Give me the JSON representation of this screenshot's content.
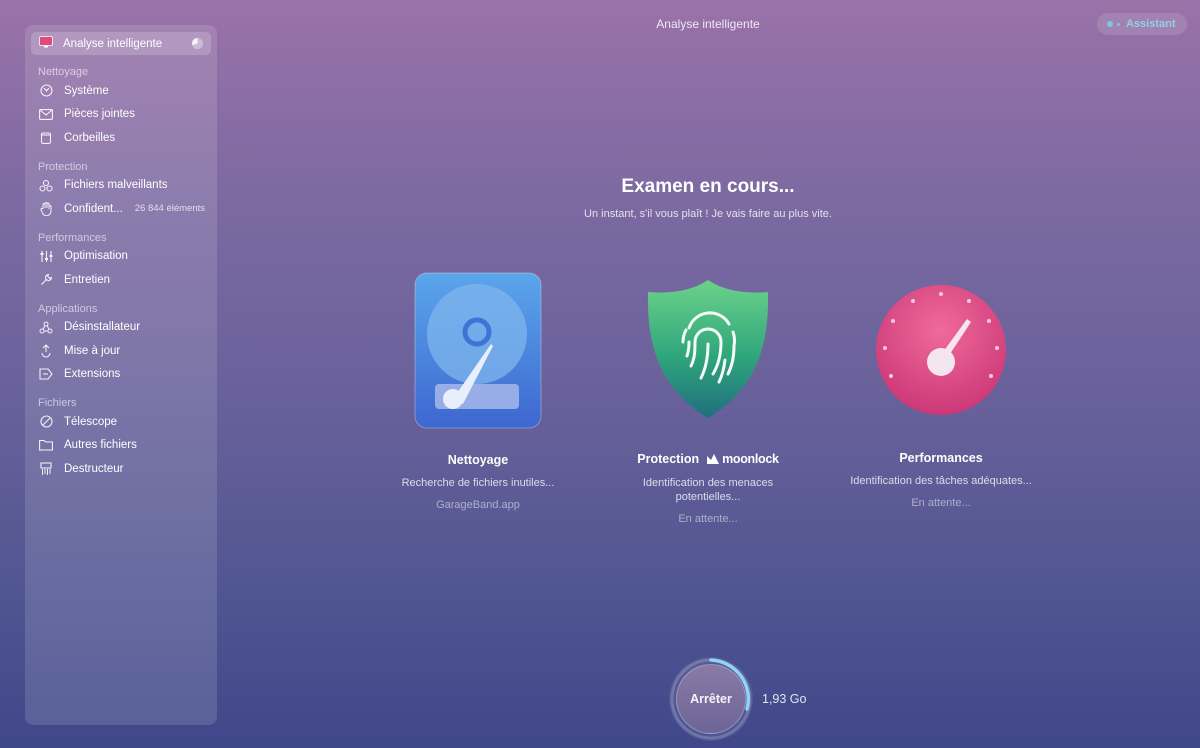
{
  "window": {
    "title": "Analyse intelligente"
  },
  "assistant": {
    "label": "Assistant"
  },
  "sidebar": {
    "top": {
      "label": "Analyse intelligente"
    },
    "sections": [
      {
        "title": "Nettoyage",
        "items": [
          {
            "label": "Système",
            "icon": "hard-drive-icon"
          },
          {
            "label": "Pièces jointes",
            "icon": "mail-icon"
          },
          {
            "label": "Corbeilles",
            "icon": "trash-icon"
          }
        ]
      },
      {
        "title": "Protection",
        "items": [
          {
            "label": "Fichiers malveillants",
            "icon": "biohazard-icon"
          },
          {
            "label": "Confident...",
            "icon": "hand-icon",
            "badge": "26 844 éléments"
          }
        ]
      },
      {
        "title": "Performances",
        "items": [
          {
            "label": "Optimisation",
            "icon": "sliders-icon"
          },
          {
            "label": "Entretien",
            "icon": "wrench-icon"
          }
        ]
      },
      {
        "title": "Applications",
        "items": [
          {
            "label": "Désinstallateur",
            "icon": "uninstall-icon"
          },
          {
            "label": "Mise à jour",
            "icon": "update-icon"
          },
          {
            "label": "Extensions",
            "icon": "extensions-icon"
          }
        ]
      },
      {
        "title": "Fichiers",
        "items": [
          {
            "label": "Télescope",
            "icon": "lens-icon"
          },
          {
            "label": "Autres fichiers",
            "icon": "folder-icon"
          },
          {
            "label": "Destructeur",
            "icon": "shredder-icon"
          }
        ]
      }
    ]
  },
  "main": {
    "headline": "Examen en cours...",
    "subline": "Un instant, s'il vous plaît ! Je vais faire au plus vite.",
    "cards": [
      {
        "name": "Nettoyage",
        "desc": "Recherche de fichiers inutiles...",
        "status": "GarageBand.app"
      },
      {
        "name": "Protection",
        "brand": "moonlock",
        "desc_line1": "Identification des menaces",
        "desc_line2": "potentielles...",
        "status": "En attente..."
      },
      {
        "name": "Performances",
        "desc": "Identification des tâches adéquates...",
        "status": "En attente..."
      }
    ]
  },
  "footer": {
    "stop_label": "Arrêter",
    "size": "1,93 Go"
  },
  "colors": {
    "accent": "#7ec6df",
    "protection_green": "#2fa67c",
    "performance_pink": "#e0457f",
    "cleanup_blue": "#4f8fe0"
  }
}
